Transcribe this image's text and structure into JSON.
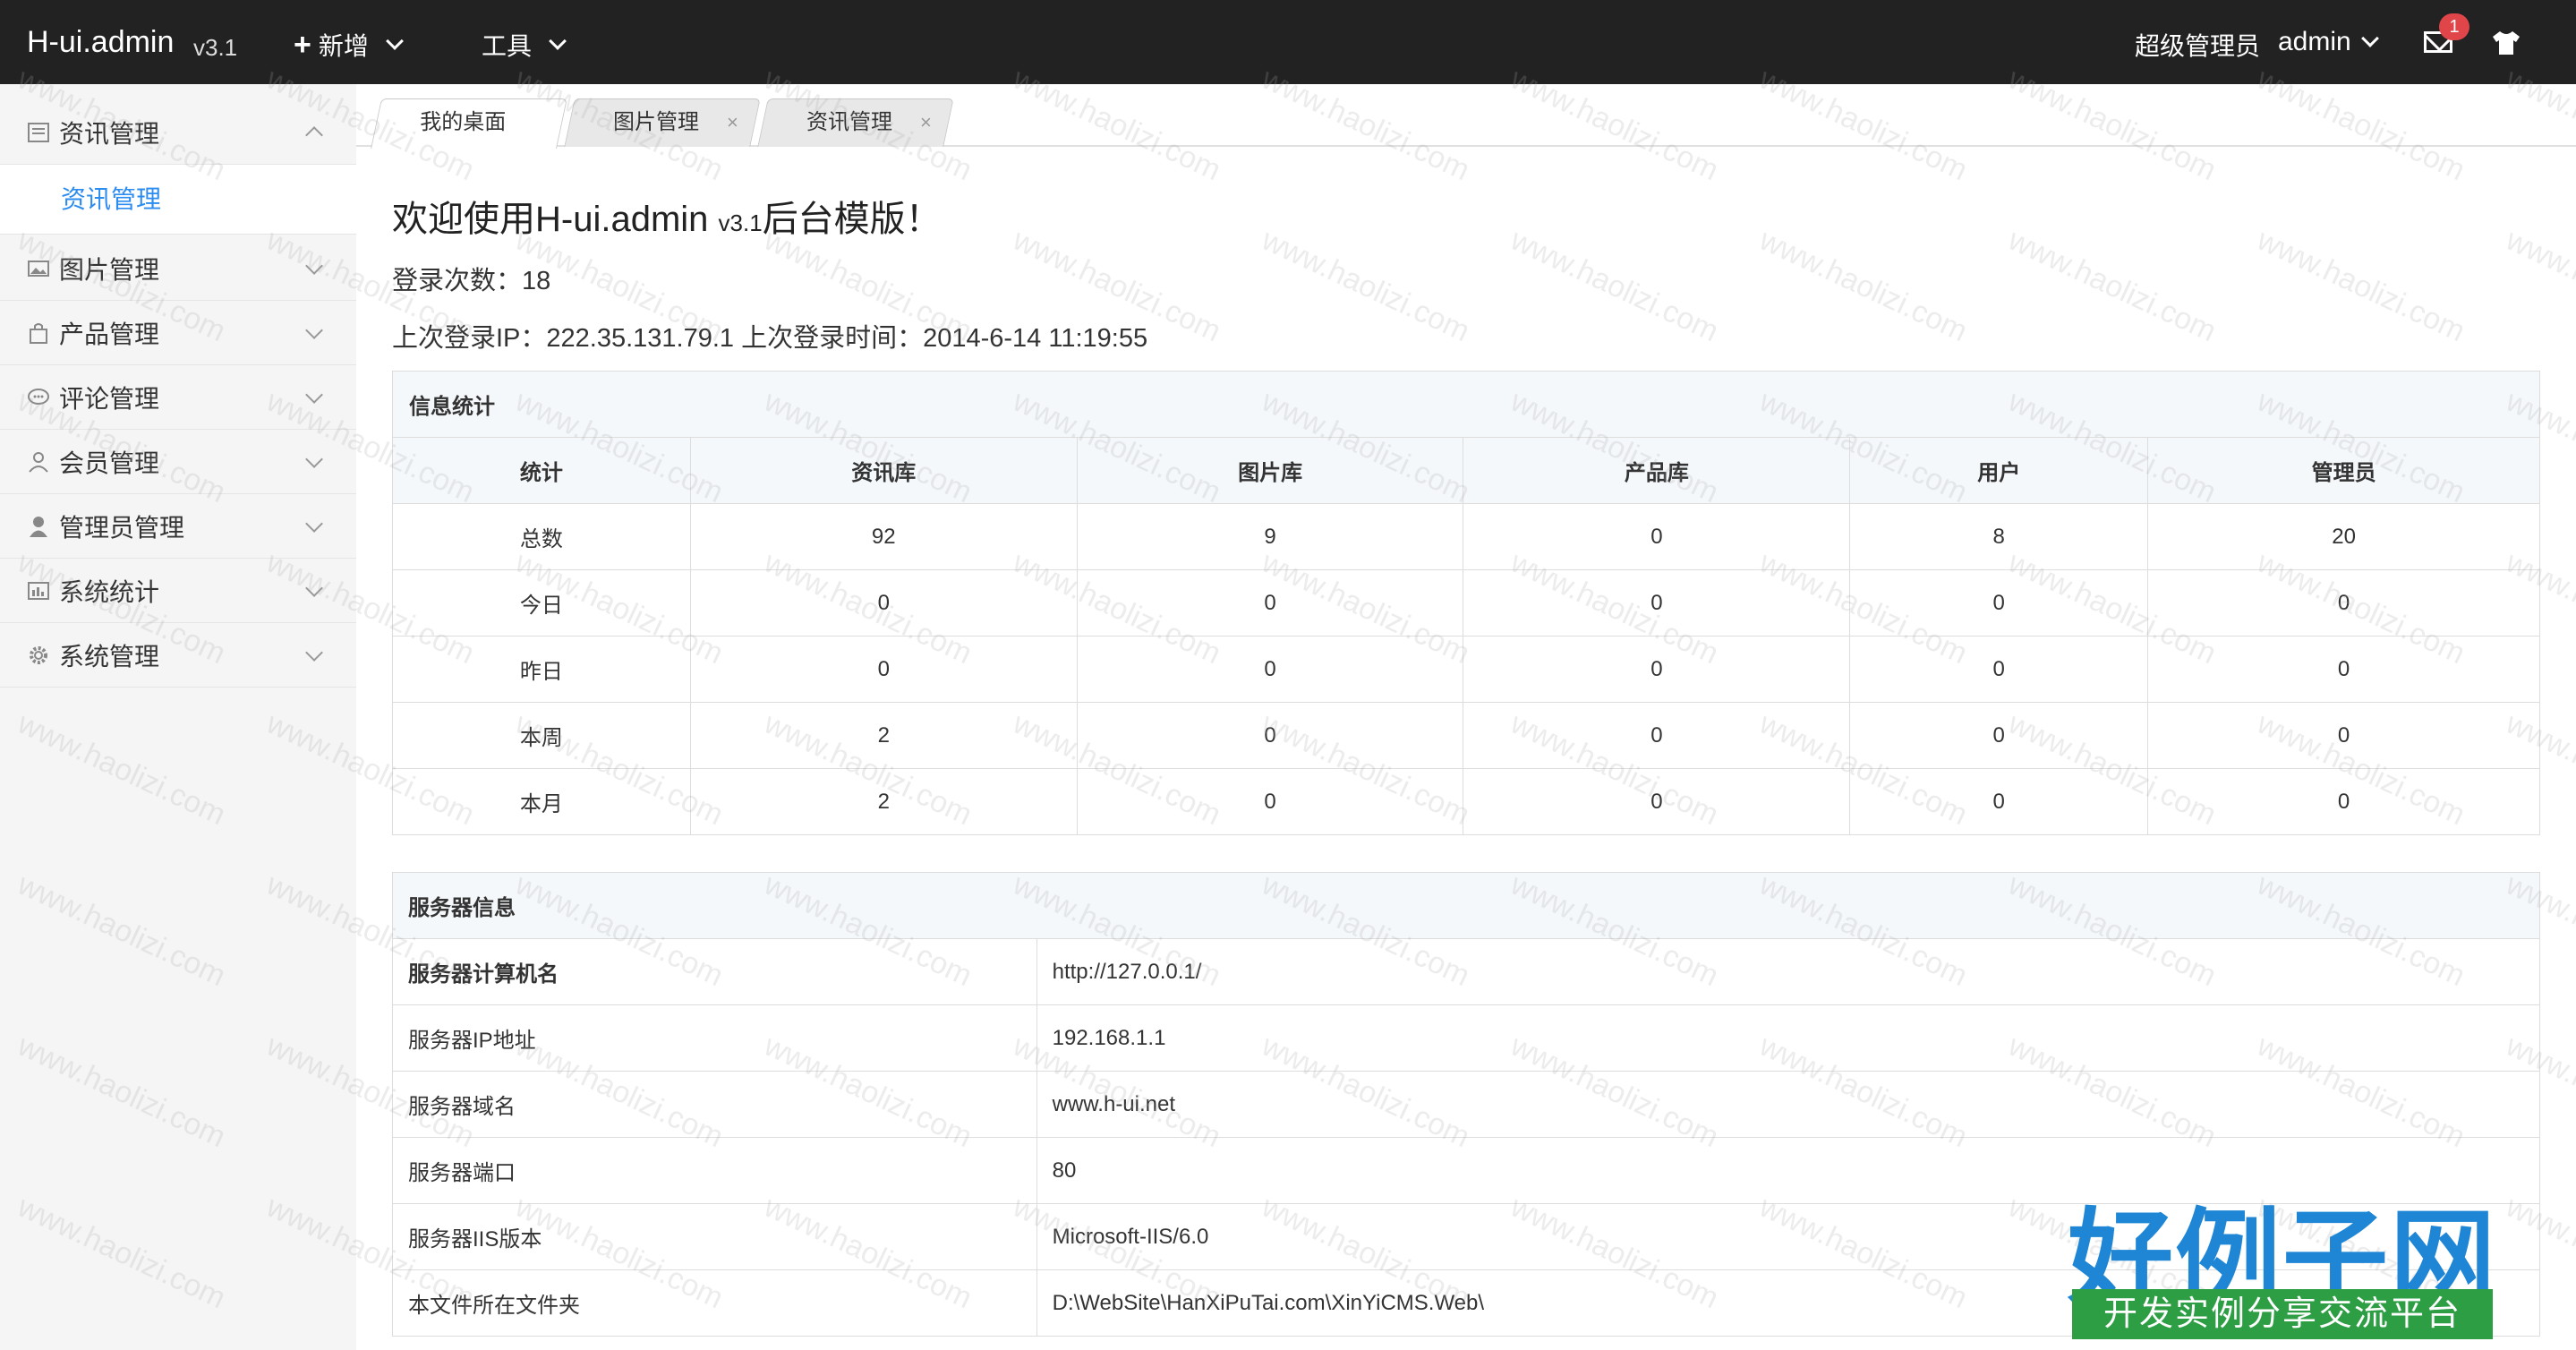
{
  "header": {
    "brand": "H-ui.admin",
    "version": "v3.1",
    "menu_add": "新增",
    "menu_tools": "工具",
    "user_role": "超级管理员",
    "user_name": "admin",
    "message_count": "1"
  },
  "sidebar": {
    "items": [
      {
        "label": "资讯管理",
        "icon": "news-icon",
        "expanded": true
      },
      {
        "label": "图片管理",
        "icon": "picture-icon"
      },
      {
        "label": "产品管理",
        "icon": "bag-icon"
      },
      {
        "label": "评论管理",
        "icon": "comment-icon"
      },
      {
        "label": "会员管理",
        "icon": "member-icon"
      },
      {
        "label": "管理员管理",
        "icon": "admin-icon"
      },
      {
        "label": "系统统计",
        "icon": "stats-icon"
      },
      {
        "label": "系统管理",
        "icon": "gear-icon"
      }
    ],
    "sub_item": "资讯管理"
  },
  "tabs": [
    "我的桌面",
    "图片管理",
    "资讯管理"
  ],
  "main": {
    "welcome": "欢迎使用H-ui.admin",
    "welcome_version": "v3.1",
    "welcome_suffix": "后台模版！",
    "login_count": "登录次数：18",
    "login_info": "上次登录IP：222.35.131.79.1 上次登录时间：2014-6-14 11:19:55"
  },
  "stats": {
    "caption": "信息统计",
    "headers": [
      "统计",
      "资讯库",
      "图片库",
      "产品库",
      "用户",
      "管理员"
    ],
    "rows": [
      [
        "总数",
        "92",
        "9",
        "0",
        "8",
        "20"
      ],
      [
        "今日",
        "0",
        "0",
        "0",
        "0",
        "0"
      ],
      [
        "昨日",
        "0",
        "0",
        "0",
        "0",
        "0"
      ],
      [
        "本周",
        "2",
        "0",
        "0",
        "0",
        "0"
      ],
      [
        "本月",
        "2",
        "0",
        "0",
        "0",
        "0"
      ]
    ]
  },
  "server": {
    "caption": "服务器信息",
    "rows": [
      [
        "服务器计算机名",
        "http://127.0.0.1/"
      ],
      [
        "服务器IP地址",
        "192.168.1.1"
      ],
      [
        "服务器域名",
        "www.h-ui.net"
      ],
      [
        "服务器端口",
        "80"
      ],
      [
        "服务器IIS版本",
        "Microsoft-IIS/6.0"
      ],
      [
        "本文件所在文件夹",
        "D:\\WebSite\\HanXiPuTai.com\\XinYiCMS.Web\\"
      ]
    ]
  },
  "watermark": "www.haolizi.com",
  "logo": {
    "title": "好例子网",
    "subtitle": "开发实例分享交流平台"
  }
}
